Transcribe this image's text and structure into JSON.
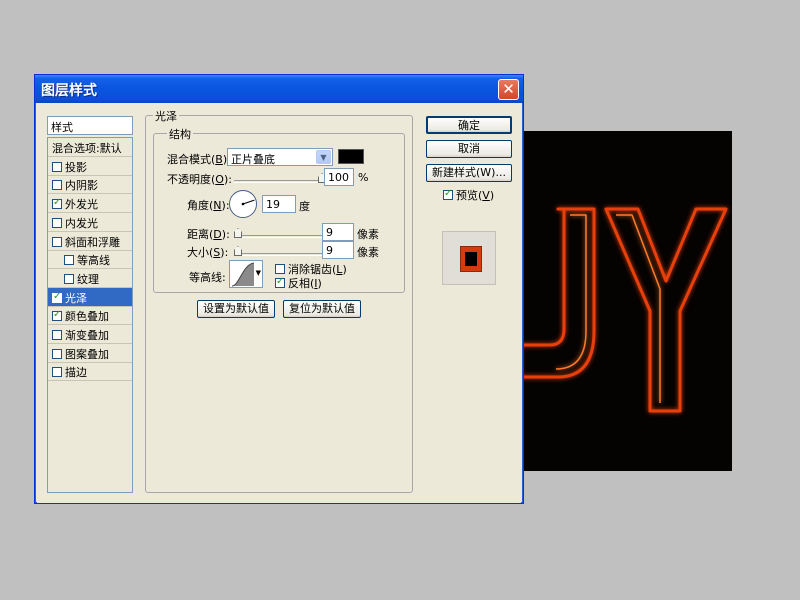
{
  "dialog": {
    "title": "图层样式",
    "close_glyph": "✕"
  },
  "styles_panel": {
    "header": "样式",
    "items": [
      {
        "label": "混合选项:默认",
        "checkbox": false,
        "checked": false,
        "indent": false,
        "selected": false
      },
      {
        "label": "投影",
        "checkbox": true,
        "checked": false,
        "indent": false,
        "selected": false
      },
      {
        "label": "内阴影",
        "checkbox": true,
        "checked": false,
        "indent": false,
        "selected": false
      },
      {
        "label": "外发光",
        "checkbox": true,
        "checked": true,
        "indent": false,
        "selected": false
      },
      {
        "label": "内发光",
        "checkbox": true,
        "checked": false,
        "indent": false,
        "selected": false
      },
      {
        "label": "斜面和浮雕",
        "checkbox": true,
        "checked": false,
        "indent": false,
        "selected": false
      },
      {
        "label": "等高线",
        "checkbox": true,
        "checked": false,
        "indent": true,
        "selected": false
      },
      {
        "label": "纹理",
        "checkbox": true,
        "checked": false,
        "indent": true,
        "selected": false
      },
      {
        "label": "光泽",
        "checkbox": true,
        "checked": true,
        "indent": false,
        "selected": true
      },
      {
        "label": "颜色叠加",
        "checkbox": true,
        "checked": true,
        "indent": false,
        "selected": false
      },
      {
        "label": "渐变叠加",
        "checkbox": true,
        "checked": false,
        "indent": false,
        "selected": false
      },
      {
        "label": "图案叠加",
        "checkbox": true,
        "checked": false,
        "indent": false,
        "selected": false
      },
      {
        "label": "描边",
        "checkbox": true,
        "checked": false,
        "indent": false,
        "selected": false
      }
    ]
  },
  "satin": {
    "group_title": "光泽",
    "structure_title": "结构",
    "blend_mode_label": "混合模式(",
    "blend_mode_key": "B",
    "blend_mode_value": "正片叠底",
    "blend_color": "#000000",
    "opacity_label": "不透明度(",
    "opacity_key": "O",
    "opacity_value": "100",
    "opacity_unit": "%",
    "angle_label": "角度(",
    "angle_key": "N",
    "angle_value": "19",
    "angle_unit": "度",
    "distance_label": "距离(",
    "distance_key": "D",
    "distance_value": "9",
    "distance_unit": "像素",
    "size_label": "大小(",
    "size_key": "S",
    "size_value": "9",
    "size_unit": "像素",
    "contour_label": "等高线:",
    "antialias_label": "消除锯齿(",
    "antialias_key": "L",
    "antialias_checked": false,
    "invert_label": "反相(",
    "invert_key": "I",
    "invert_checked": true,
    "set_default_button": "设置为默认值",
    "reset_default_button": "复位为默认值"
  },
  "right_buttons": {
    "ok": "确定",
    "cancel": "取消",
    "new_style": "新建样式(W)...",
    "preview_label": "预览(",
    "preview_key": "V",
    "preview_checked": true
  },
  "canvas": {
    "text": "JY",
    "glow_color": "#e8400c",
    "background": "#050202"
  }
}
